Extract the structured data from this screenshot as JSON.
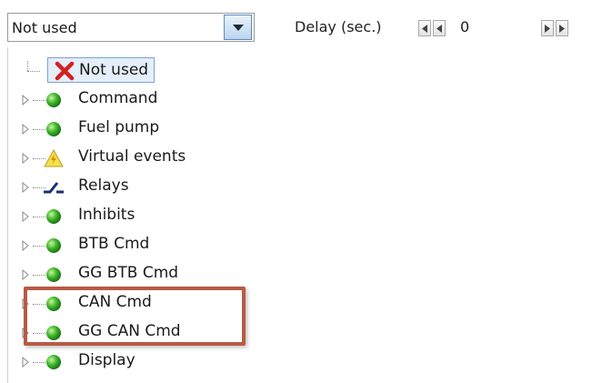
{
  "toolbar": {
    "combo_value": "Not used",
    "delay_label": "Delay (sec.)",
    "delay_value": "0"
  },
  "tree": {
    "items": [
      {
        "label": "Not used",
        "icon": "red-x-icon",
        "selected": true,
        "expandable": false
      },
      {
        "label": "Command",
        "icon": "green-ball-icon",
        "expandable": true
      },
      {
        "label": "Fuel pump",
        "icon": "green-ball-icon",
        "expandable": true
      },
      {
        "label": "Virtual events",
        "icon": "warning-bolt-icon",
        "expandable": true
      },
      {
        "label": "Relays",
        "icon": "relay-switch-icon",
        "expandable": true
      },
      {
        "label": "Inhibits",
        "icon": "green-ball-icon",
        "expandable": true
      },
      {
        "label": "BTB Cmd",
        "icon": "green-ball-icon",
        "expandable": true
      },
      {
        "label": "GG BTB Cmd",
        "icon": "green-ball-icon",
        "expandable": true
      },
      {
        "label": "CAN Cmd",
        "icon": "green-ball-icon",
        "expandable": true
      },
      {
        "label": "GG CAN Cmd",
        "icon": "green-ball-icon",
        "expandable": true
      },
      {
        "label": "Display",
        "icon": "green-ball-icon",
        "expandable": true
      }
    ]
  },
  "colors": {
    "highlight_box": "#b85a45",
    "selection_bg": "#e5eefb",
    "selection_border": "#7da2ce"
  }
}
